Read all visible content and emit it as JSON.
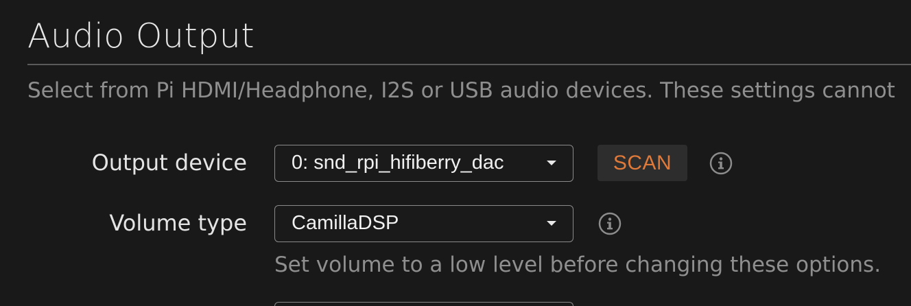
{
  "section": {
    "title": "Audio Output",
    "description": "Select from Pi HDMI/Headphone, I2S or USB audio devices. These settings cannot"
  },
  "output_device": {
    "label": "Output device",
    "value": "0: snd_rpi_hifiberry_dac",
    "scan_label": "SCAN",
    "info_icon": "info-icon"
  },
  "volume_type": {
    "label": "Volume type",
    "value": "CamillaDSP",
    "info_icon": "info-icon",
    "hint": "Set volume to a low level before changing these options."
  },
  "colors": {
    "background": "#191919",
    "accent": "#e07a3a",
    "muted_text": "#8f8f8f"
  }
}
